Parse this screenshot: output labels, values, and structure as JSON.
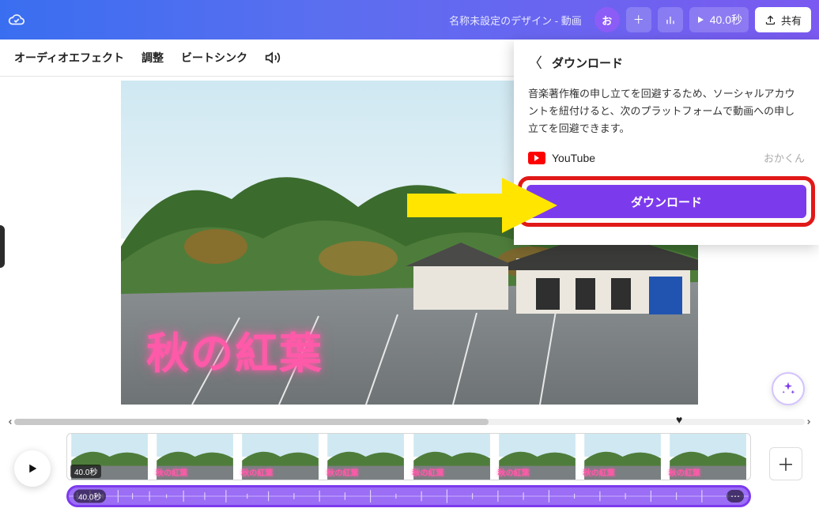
{
  "header": {
    "design_title": "名称未設定のデザイン - 動画",
    "avatar_letter": "お",
    "duration": "40.0秒",
    "share_label": "共有"
  },
  "subbar": {
    "tabs": [
      "オーディオエフェクト",
      "調整",
      "ビートシンク"
    ]
  },
  "canvas": {
    "overlay_text": "秋の紅葉"
  },
  "download_panel": {
    "title": "ダウンロード",
    "description": "音楽著作権の申し立てを回避するため、ソーシャルアカウントを紐付けると、次のプラットフォームで動画への申し立てを回避できます。",
    "youtube_label": "YouTube",
    "youtube_user": "おかくん",
    "button_label": "ダウンロード"
  },
  "timeline": {
    "video_duration": "40.0秒",
    "thumb_label": "秋の紅葉",
    "audio_duration": "40.0秒"
  }
}
